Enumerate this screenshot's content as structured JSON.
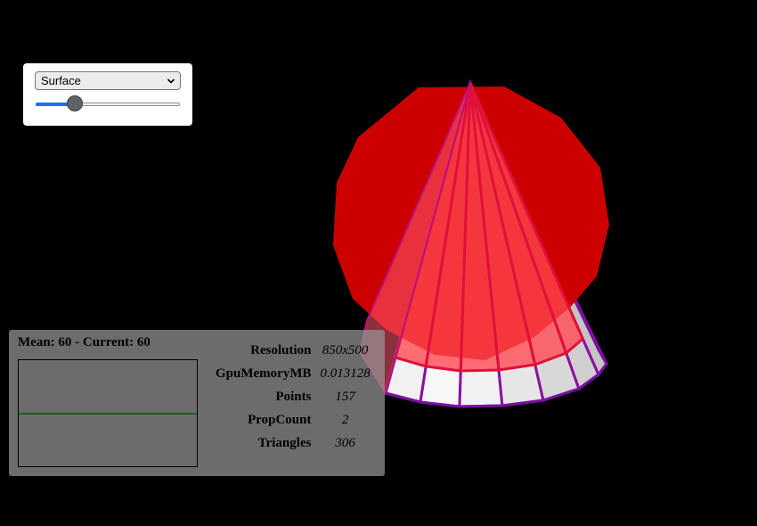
{
  "controls": {
    "representation": {
      "selected": "Surface"
    },
    "resolution_slider": {
      "fraction": 0.27
    }
  },
  "stats": {
    "fps_label": "Mean: 60 - Current: 60",
    "rows": [
      {
        "key": "Resolution",
        "value": "850x500"
      },
      {
        "key": "GpuMemoryMB",
        "value": "0.013128"
      },
      {
        "key": "Points",
        "value": "157"
      },
      {
        "key": "PropCount",
        "value": "2"
      },
      {
        "key": "Triangles",
        "value": "306"
      }
    ]
  },
  "colors": {
    "background": "#000000",
    "sphere": "#cc0000",
    "cone_face": "#ff3b45",
    "cone_edge": "#8b10a0",
    "slider_accent": "#1a73e8"
  }
}
